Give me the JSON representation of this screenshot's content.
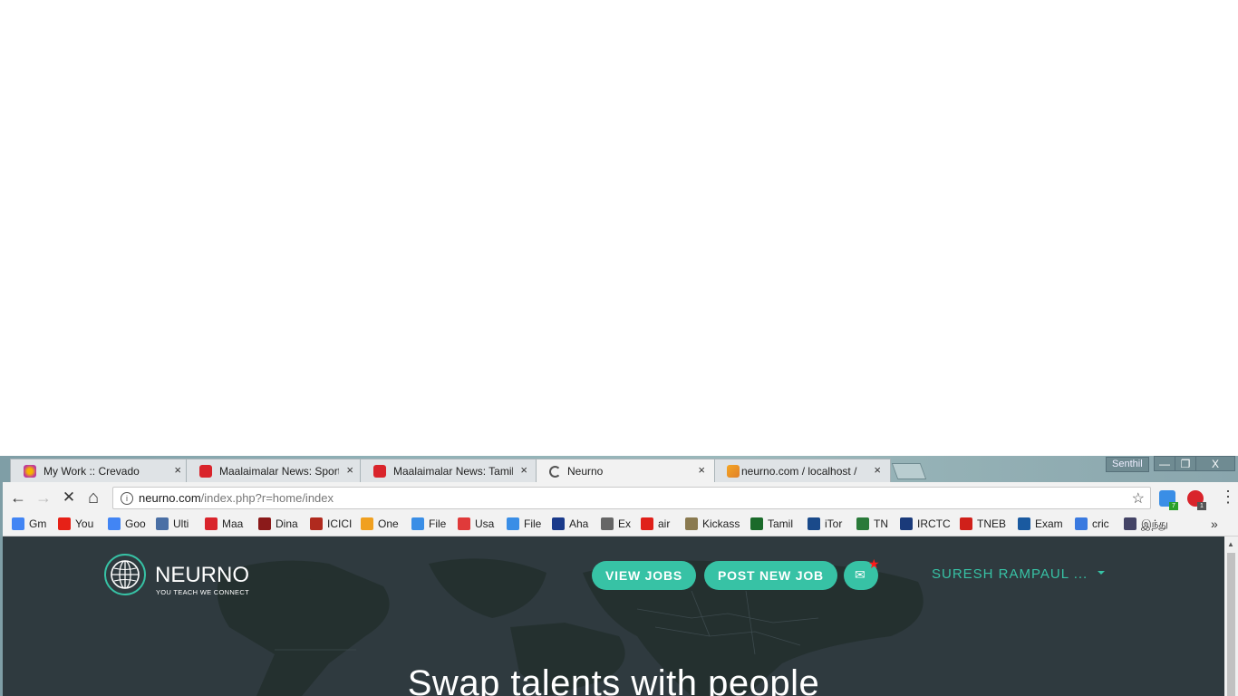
{
  "window": {
    "user": "Senthil",
    "minimize": "—",
    "restore": "❐",
    "close": "X"
  },
  "tabs": [
    {
      "title": "My Work :: Crevado",
      "close": "×"
    },
    {
      "title": "Maalaimalar News: Sport",
      "close": "×"
    },
    {
      "title": "Maalaimalar News: Tamil",
      "close": "×"
    },
    {
      "title": "Neurno",
      "close": "×"
    },
    {
      "title": "neurno.com / localhost /",
      "close": "×"
    }
  ],
  "toolbar": {
    "back": "←",
    "forward": "→",
    "stop": "✕",
    "home": "⌂",
    "info": "i",
    "url_host": "neurno.com",
    "url_path": "/index.php?r=home/index",
    "star": "☆",
    "ext1_badge": "7",
    "ext2_badge": "1",
    "menu": "⋮"
  },
  "bookmarks": [
    {
      "label": "Gm",
      "color": "#4285f4"
    },
    {
      "label": "You",
      "color": "#e62117"
    },
    {
      "label": "Goo",
      "color": "#4285f4"
    },
    {
      "label": "Ulti",
      "color": "#4a6fa5"
    },
    {
      "label": "Maa",
      "color": "#d9242b"
    },
    {
      "label": "Dina",
      "color": "#8b1a1a"
    },
    {
      "label": "ICICI",
      "color": "#b02a1e"
    },
    {
      "label": "One",
      "color": "#f0a020"
    },
    {
      "label": "File",
      "color": "#3a8ee6"
    },
    {
      "label": "Usa",
      "color": "#e03a3a"
    },
    {
      "label": "File",
      "color": "#3a8ee6"
    },
    {
      "label": "Aha",
      "color": "#1a3a8b"
    },
    {
      "label": "Ex",
      "color": "#666666"
    },
    {
      "label": "air",
      "color": "#e0201a"
    },
    {
      "label": "Kickass",
      "color": "#8a7a50"
    },
    {
      "label": "Tamil",
      "color": "#1a6a2a"
    },
    {
      "label": "iTor",
      "color": "#1a4a8a"
    },
    {
      "label": "TN",
      "color": "#2a7a3a"
    },
    {
      "label": "IRCTC",
      "color": "#1a3a7a"
    },
    {
      "label": "TNEB",
      "color": "#d0201a"
    },
    {
      "label": "Exam",
      "color": "#1a5aa0"
    },
    {
      "label": "cric",
      "color": "#3a7ae0"
    },
    {
      "label": "இந்து",
      "color": "#444466"
    }
  ],
  "bookmarks_more": "»",
  "site": {
    "brand": "NEURNO",
    "tagline": "YOU TEACH WE CONNECT",
    "view_jobs": "VIEW JOBS",
    "post_job": "POST NEW JOB",
    "mail_icon": "✉",
    "notif_star": "★",
    "user": "SURESH RAMPAUL ...",
    "hero": "Swap talents with people",
    "accent": "#37c2a5",
    "background": "#2f3a3f"
  },
  "scrollbar": {
    "up": "▲"
  }
}
